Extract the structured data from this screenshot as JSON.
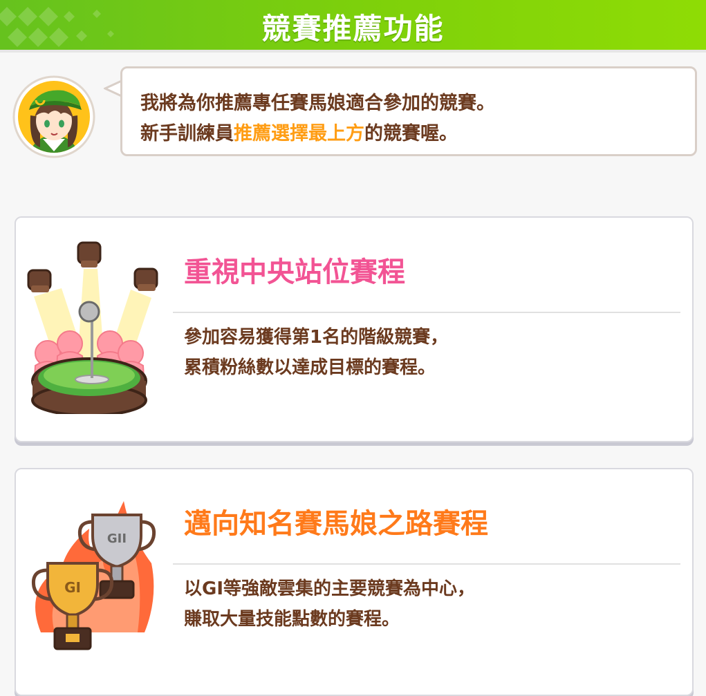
{
  "header": {
    "title": "競賽推薦功能"
  },
  "advisor": {
    "line1": "我將為你推薦專任賽馬娘適合參加的競賽。",
    "line2_prefix": "新手訓練員",
    "line2_highlight": "推薦選擇最上方",
    "line2_suffix": "的競賽喔。"
  },
  "cards": [
    {
      "title": "重視中央站位賽程",
      "desc1": "參加容易獲得第1名的階級競賽，",
      "desc2": "累積粉絲數以達成目標的賽程。",
      "icon": "stage-microphone-icon",
      "title_color": "#f25494"
    },
    {
      "title": "邁向知名賽馬娘之路賽程",
      "desc1": "以GⅠ等強敵雲集的主要競賽為中心，",
      "desc2": "賺取大量技能點數的賽程。",
      "icon": "trophy-icon",
      "title_color": "#ff7a1a",
      "trophy_labels": [
        "GI",
        "GII"
      ]
    }
  ],
  "colors": {
    "header_green": "#7fd10a",
    "text_brown": "#6b3a1f",
    "highlight_orange": "#ff9d14"
  }
}
